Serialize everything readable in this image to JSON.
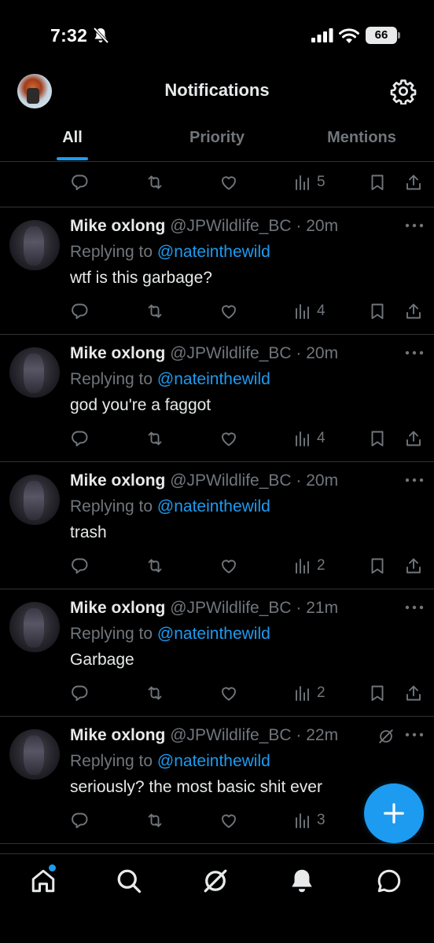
{
  "status_bar": {
    "time": "7:32",
    "battery": "66"
  },
  "header": {
    "title": "Notifications"
  },
  "tabs": [
    {
      "label": "All",
      "active": true
    },
    {
      "label": "Priority",
      "active": false
    },
    {
      "label": "Mentions",
      "active": false
    }
  ],
  "top_partial": {
    "views": "5"
  },
  "posts": [
    {
      "name": "Mike oxlong",
      "handle": "@JPWildlife_BC",
      "time": "20m",
      "replying_label": "Replying to",
      "replying_to": "@nateinthewild",
      "text": "wtf is this garbage?",
      "views": "4"
    },
    {
      "name": "Mike oxlong",
      "handle": "@JPWildlife_BC",
      "time": "20m",
      "replying_label": "Replying to",
      "replying_to": "@nateinthewild",
      "text": "god you're a faggot",
      "views": "4"
    },
    {
      "name": "Mike oxlong",
      "handle": "@JPWildlife_BC",
      "time": "20m",
      "replying_label": "Replying to",
      "replying_to": "@nateinthewild",
      "text": "trash",
      "views": "2"
    },
    {
      "name": "Mike oxlong",
      "handle": "@JPWildlife_BC",
      "time": "21m",
      "replying_label": "Replying to",
      "replying_to": "@nateinthewild",
      "text": "Garbage",
      "views": "2"
    },
    {
      "name": "Mike oxlong",
      "handle": "@JPWildlife_BC",
      "time": "22m",
      "replying_label": "Replying to",
      "replying_to": "@nateinthewild",
      "text": "seriously? the most basic shit ever",
      "views": "3"
    }
  ],
  "colors": {
    "accent": "#1d9bf0",
    "background": "#000000",
    "muted": "#71767b",
    "text": "#e7e9ea",
    "divider": "#2f3336"
  },
  "icons": [
    "reply-icon",
    "retweet-icon",
    "like-icon",
    "views-icon",
    "bookmark-icon",
    "share-icon",
    "more-icon",
    "grok-icon",
    "home-icon",
    "search-icon",
    "notifications-icon",
    "messages-icon",
    "compose-icon",
    "settings-icon"
  ]
}
